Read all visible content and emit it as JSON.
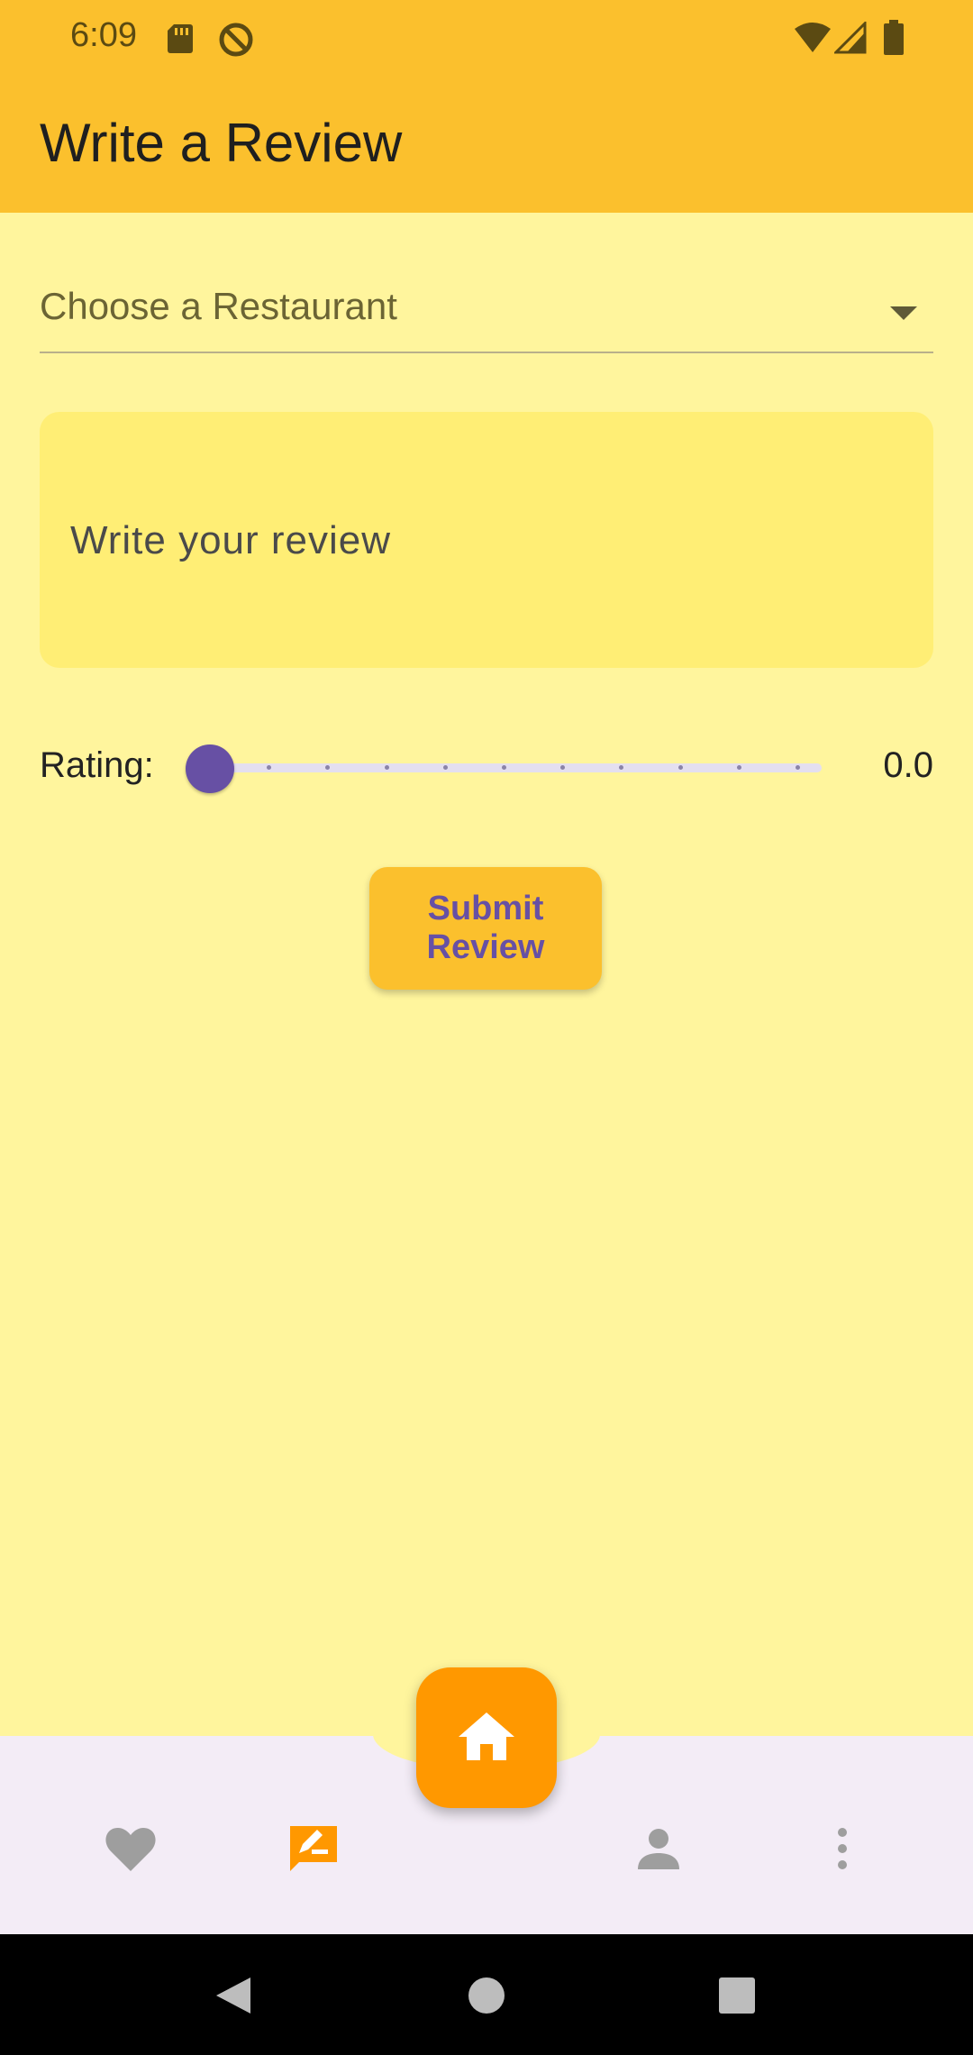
{
  "status_bar": {
    "time": "6:09",
    "left_icons": [
      "sd-card-icon",
      "no-sync-icon"
    ],
    "right_icons": [
      "wifi-icon",
      "cell-signal-icon",
      "battery-icon"
    ]
  },
  "app_bar": {
    "title": "Write a Review"
  },
  "form": {
    "restaurant_dropdown": {
      "selected_label": "Choose a Restaurant",
      "icon": "dropdown-arrow-icon"
    },
    "review_field": {
      "placeholder": "Write your review",
      "value": ""
    },
    "rating": {
      "label": "Rating:",
      "value": 0.0,
      "value_text": "0.0",
      "min": 0,
      "max": 10,
      "divisions": 10
    },
    "submit_label": "Submit Review"
  },
  "bottom_nav": {
    "items": [
      {
        "icon": "heart-icon",
        "active": false
      },
      {
        "icon": "rate-review-icon",
        "active": true
      },
      {
        "icon": "person-icon",
        "active": false
      },
      {
        "icon": "more-vert-icon",
        "active": false
      }
    ],
    "fab_icon": "home-icon",
    "fab_color": "#FF9800"
  },
  "system_nav": {
    "icons": [
      "back-icon",
      "home-circle-icon",
      "recents-icon"
    ]
  },
  "colors": {
    "app_bar": "#FBC02D",
    "background": "#FFF59D",
    "text_field_fill": "#FFEE75",
    "slider_accent": "#6750A4",
    "submit_button": "#FBC02D",
    "submit_text": "#6750A4",
    "nav_background": "#F3ECF6",
    "nav_active": "#FF9800",
    "nav_inactive": "#9E9E9E"
  }
}
